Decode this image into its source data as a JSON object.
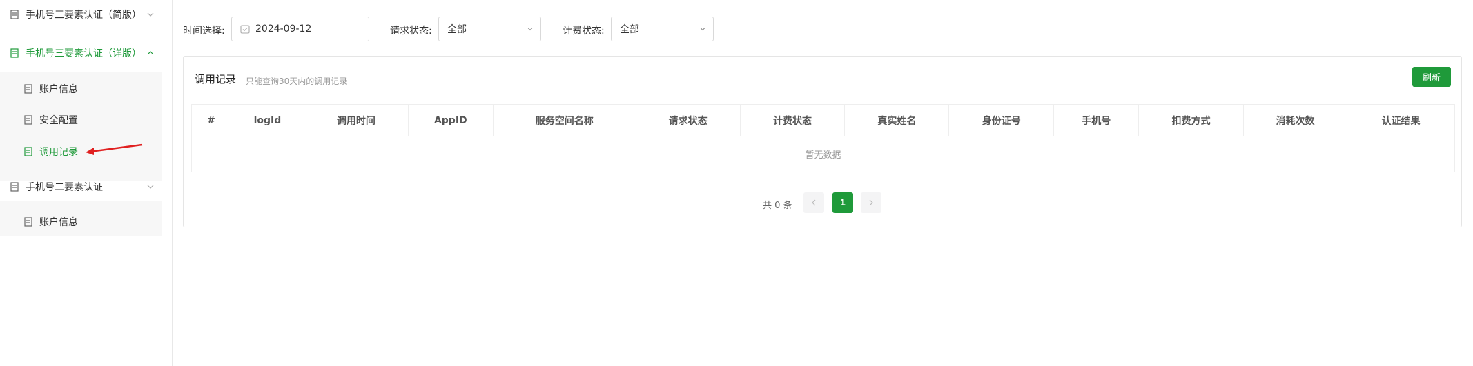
{
  "sidebar": {
    "items": [
      {
        "label": "手机号三要素认证（简版）",
        "expanded": false
      },
      {
        "label": "手机号三要素认证（详版）",
        "expanded": true
      },
      {
        "label": "账户信息"
      },
      {
        "label": "安全配置"
      },
      {
        "label": "调用记录",
        "active": true
      },
      {
        "label": "手机号二要素认证",
        "expanded": false
      },
      {
        "label": "账户信息"
      }
    ]
  },
  "filters": {
    "time_label": "时间选择:",
    "time_value": "2024-09-12",
    "request_status_label": "请求状态:",
    "request_status_value": "全部",
    "billing_status_label": "计费状态:",
    "billing_status_value": "全部"
  },
  "card": {
    "title": "调用记录",
    "subtitle": "只能查询30天内的调用记录",
    "refresh_label": "刷新"
  },
  "table": {
    "columns": [
      "#",
      "logId",
      "调用时间",
      "AppID",
      "服务空间名称",
      "请求状态",
      "计费状态",
      "真实姓名",
      "身份证号",
      "手机号",
      "扣费方式",
      "消耗次数",
      "认证结果"
    ],
    "empty_text": "暂无数据"
  },
  "pagination": {
    "total_text": "共 0 条",
    "current_page": "1"
  },
  "colors": {
    "accent": "#1f9a3a",
    "annotation_arrow": "#e02020"
  }
}
